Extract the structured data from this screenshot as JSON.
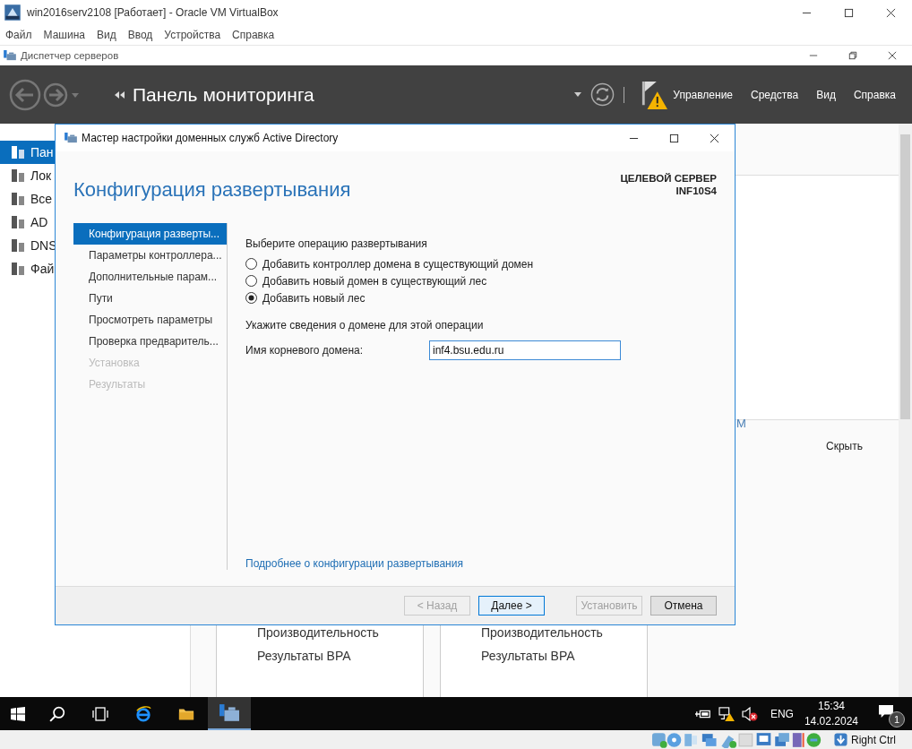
{
  "vm_window": {
    "title": "win2016serv2108 [Работает] - Oracle VM VirtualBox"
  },
  "vm_menu": [
    "Файл",
    "Машина",
    "Вид",
    "Ввод",
    "Устройства",
    "Справка"
  ],
  "app_window": {
    "title": "Диспетчер серверов"
  },
  "header": {
    "title": "Панель мониторинга",
    "menu": [
      "Управление",
      "Средства",
      "Вид",
      "Справка"
    ]
  },
  "sidebar": [
    {
      "label": "Пан",
      "selected": true
    },
    {
      "label": "Лок",
      "selected": false
    },
    {
      "label": "Все",
      "selected": false
    },
    {
      "label": "AD",
      "selected": false
    },
    {
      "label": "DNS",
      "selected": false
    },
    {
      "label": "Фай",
      "selected": false
    }
  ],
  "background": {
    "side_panel": {
      "text": "M",
      "link": "Скрыть"
    },
    "tiles": [
      {
        "lines": [
          "Производительность",
          "Результаты BPA"
        ]
      },
      {
        "lines": [
          "Производительность",
          "Результаты BPA"
        ]
      }
    ]
  },
  "dialog": {
    "title": "Мастер настройки доменных служб Active Directory",
    "heading": "Конфигурация развертывания",
    "target_label": "ЦЕЛЕВОЙ СЕРВЕР",
    "target_name": "INF10S4",
    "steps": [
      {
        "label": "Конфигурация разверты...",
        "selected": true,
        "disabled": false
      },
      {
        "label": "Параметры контроллера...",
        "selected": false,
        "disabled": false
      },
      {
        "label": "Дополнительные парам...",
        "selected": false,
        "disabled": false
      },
      {
        "label": "Пути",
        "selected": false,
        "disabled": false
      },
      {
        "label": "Просмотреть параметры",
        "selected": false,
        "disabled": false
      },
      {
        "label": "Проверка предваритель...",
        "selected": false,
        "disabled": false
      },
      {
        "label": "Установка",
        "selected": false,
        "disabled": true
      },
      {
        "label": "Результаты",
        "selected": false,
        "disabled": true
      }
    ],
    "operation_prompt": "Выберите операцию развертывания",
    "operations": [
      {
        "label": "Добавить контроллер домена в существующий домен",
        "selected": false
      },
      {
        "label": "Добавить новый домен в существующий лес",
        "selected": false
      },
      {
        "label": "Добавить новый лес",
        "selected": true
      }
    ],
    "domain_prompt": "Укажите сведения о домене для этой операции",
    "root_domain": {
      "label": "Имя корневого домена:",
      "value": "inf4.bsu.edu.ru"
    },
    "more_link": "Подробнее о конфигурации развертывания",
    "buttons": [
      {
        "label": "< Назад",
        "disabled": true,
        "default": false
      },
      {
        "label": "Далее >",
        "disabled": false,
        "default": true
      },
      {
        "label": "Установить",
        "disabled": true,
        "default": false
      },
      {
        "label": "Отмена",
        "disabled": false,
        "default": false
      }
    ]
  },
  "taskbar": {
    "language": "ENG",
    "time": "15:34",
    "date": "14.02.2024",
    "notifications": "1"
  },
  "vm_status": {
    "host_key": "Right Ctrl"
  }
}
